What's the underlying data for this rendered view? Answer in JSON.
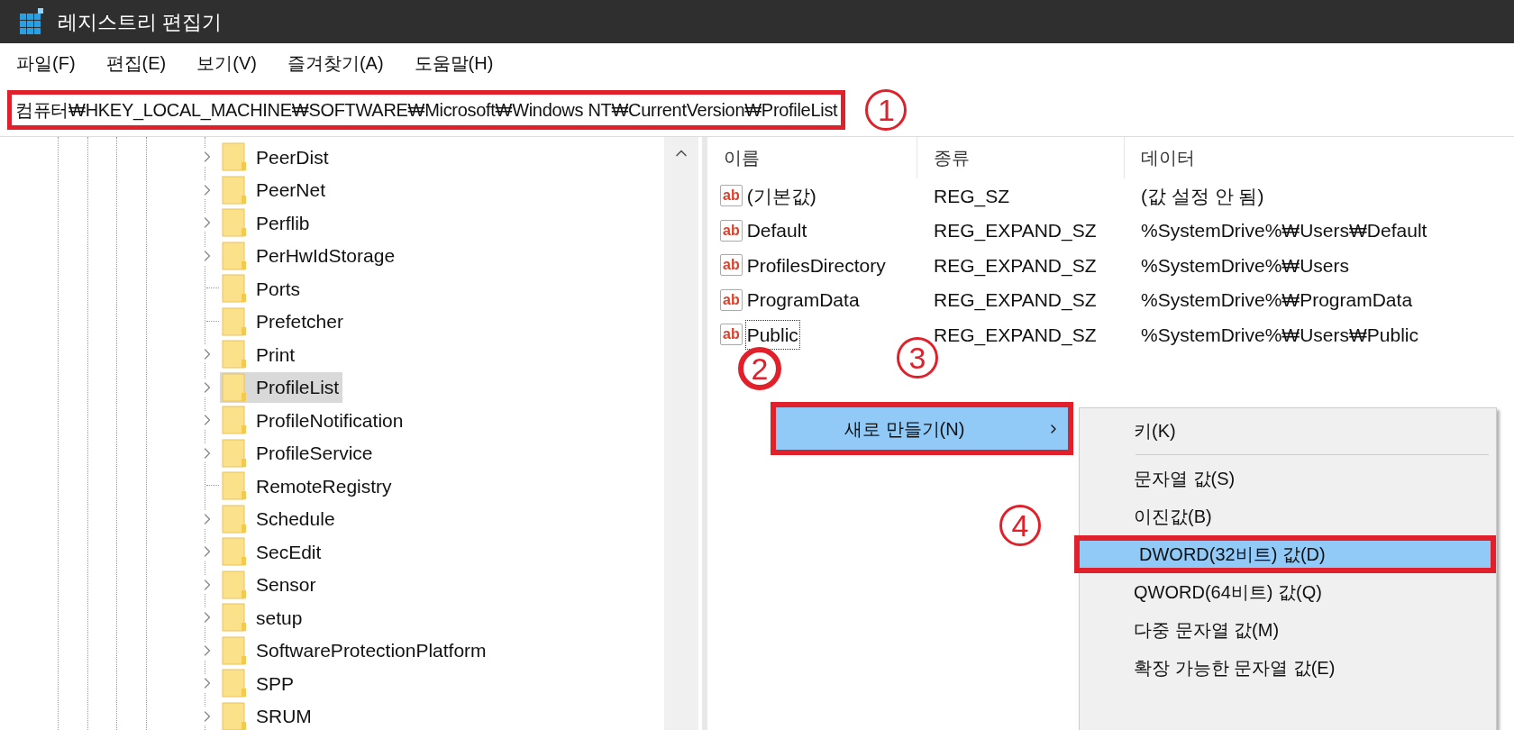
{
  "window": {
    "title": "레지스트리 편집기"
  },
  "menu": [
    "파일(F)",
    "편집(E)",
    "보기(V)",
    "즐겨찾기(A)",
    "도움말(H)"
  ],
  "address": {
    "value": "컴퓨터₩HKEY_LOCAL_MACHINE₩SOFTWARE₩Microsoft₩Windows NT₩CurrentVersion₩ProfileList",
    "highlighted": true
  },
  "tree": [
    {
      "name": "PeerDist",
      "has_children": true,
      "selected": false
    },
    {
      "name": "PeerNet",
      "has_children": true,
      "selected": false
    },
    {
      "name": "Perflib",
      "has_children": true,
      "selected": false
    },
    {
      "name": "PerHwIdStorage",
      "has_children": true,
      "selected": false
    },
    {
      "name": "Ports",
      "has_children": false,
      "selected": false
    },
    {
      "name": "Prefetcher",
      "has_children": false,
      "selected": false
    },
    {
      "name": "Print",
      "has_children": true,
      "selected": false
    },
    {
      "name": "ProfileList",
      "has_children": true,
      "selected": true
    },
    {
      "name": "ProfileNotification",
      "has_children": true,
      "selected": false
    },
    {
      "name": "ProfileService",
      "has_children": true,
      "selected": false
    },
    {
      "name": "RemoteRegistry",
      "has_children": false,
      "selected": false
    },
    {
      "name": "Schedule",
      "has_children": true,
      "selected": false
    },
    {
      "name": "SecEdit",
      "has_children": true,
      "selected": false
    },
    {
      "name": "Sensor",
      "has_children": true,
      "selected": false
    },
    {
      "name": "setup",
      "has_children": true,
      "selected": false
    },
    {
      "name": "SoftwareProtectionPlatform",
      "has_children": true,
      "selected": false
    },
    {
      "name": "SPP",
      "has_children": true,
      "selected": false
    },
    {
      "name": "SRUM",
      "has_children": true,
      "selected": false
    }
  ],
  "values": {
    "columns": [
      "이름",
      "종류",
      "데이터"
    ],
    "rows": [
      {
        "icon": "ab",
        "name": "(기본값)",
        "type": "REG_SZ",
        "data": "(값 설정 안 됨)",
        "focused": false
      },
      {
        "icon": "ab",
        "name": "Default",
        "type": "REG_EXPAND_SZ",
        "data": "%SystemDrive%₩Users₩Default",
        "focused": false
      },
      {
        "icon": "ab",
        "name": "ProfilesDirectory",
        "type": "REG_EXPAND_SZ",
        "data": "%SystemDrive%₩Users",
        "focused": false
      },
      {
        "icon": "ab",
        "name": "ProgramData",
        "type": "REG_EXPAND_SZ",
        "data": "%SystemDrive%₩ProgramData",
        "focused": false
      },
      {
        "icon": "ab",
        "name": "Public",
        "type": "REG_EXPAND_SZ",
        "data": "%SystemDrive%₩Users₩Public",
        "focused": true
      }
    ]
  },
  "context_menu": {
    "label": "새로 만들기(N)",
    "selected": true,
    "highlighted": true
  },
  "submenu": [
    {
      "kind": "item",
      "label": "키(K)",
      "selected": false,
      "highlighted": false
    },
    {
      "kind": "separator"
    },
    {
      "kind": "item",
      "label": "문자열 값(S)",
      "selected": false,
      "highlighted": false
    },
    {
      "kind": "item",
      "label": "이진값(B)",
      "selected": false,
      "highlighted": false
    },
    {
      "kind": "item",
      "label": "DWORD(32비트) 값(D)",
      "selected": true,
      "highlighted": true
    },
    {
      "kind": "item",
      "label": "QWORD(64비트) 값(Q)",
      "selected": false,
      "highlighted": false
    },
    {
      "kind": "item",
      "label": "다중 문자열 값(M)",
      "selected": false,
      "highlighted": false
    },
    {
      "kind": "item",
      "label": "확장 가능한 문자열 값(E)",
      "selected": false,
      "highlighted": false
    }
  ],
  "annotations": [
    {
      "label": "1",
      "bold": false
    },
    {
      "label": "2",
      "bold": true
    },
    {
      "label": "3",
      "bold": false
    },
    {
      "label": "4",
      "bold": false
    }
  ]
}
